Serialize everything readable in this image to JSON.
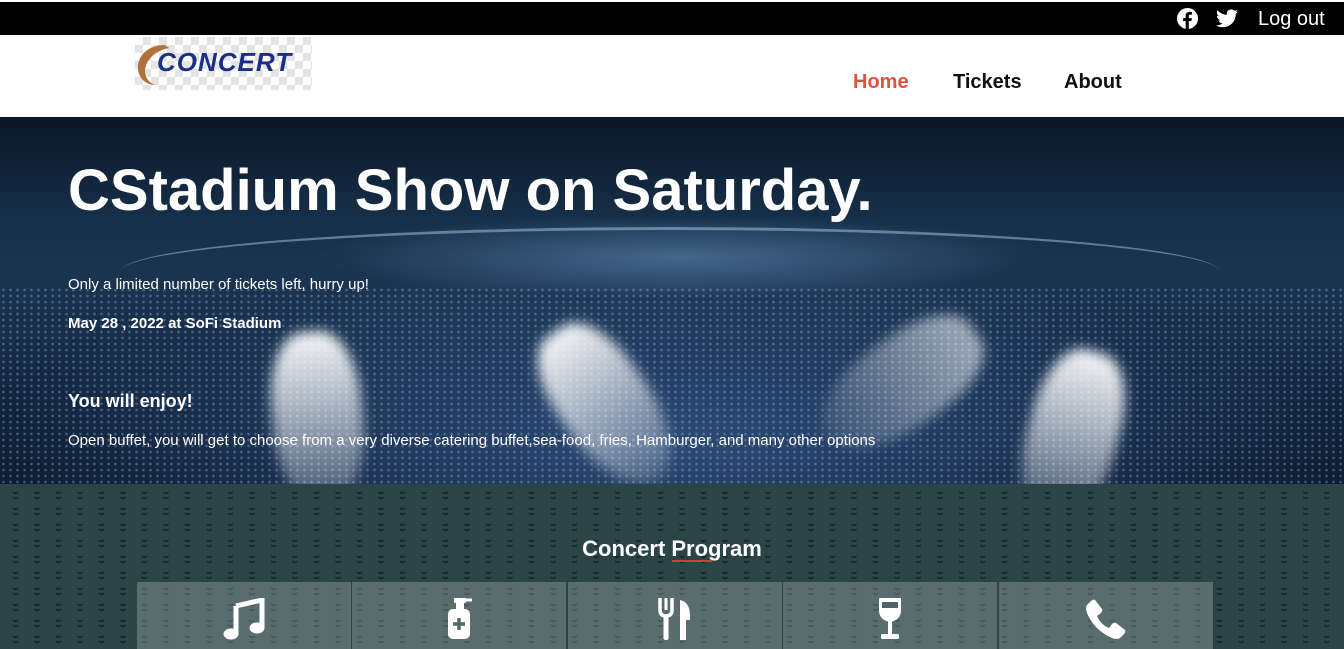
{
  "topbar": {
    "logout_label": "Log out",
    "icons": [
      "facebook-icon",
      "twitter-icon"
    ]
  },
  "header": {
    "logo_text": "CONCERT",
    "nav": {
      "home": "Home",
      "tickets": "Tickets",
      "about": "About"
    }
  },
  "hero": {
    "title": "CStadium Show on Saturday.",
    "subtitle": "Only a limited number of tickets left, hurry up!",
    "date_venue": "May 28 , 2022 at SoFi Stadium",
    "enjoy_heading": "You will enjoy!",
    "enjoy_text": "Open buffet, you will get to choose from a very diverse catering buffet,sea-food, fries, Hamburger, and many other options"
  },
  "program": {
    "title": "Concert Program",
    "cards": [
      "music-icon",
      "hand-sanitizer-icon",
      "utensils-icon",
      "wine-glass-icon",
      "phone-icon"
    ]
  },
  "colors": {
    "accent": "#e0533f",
    "topbar": "#000000",
    "program_bg": "#2b4447",
    "logo_blue": "#1c2f86"
  }
}
